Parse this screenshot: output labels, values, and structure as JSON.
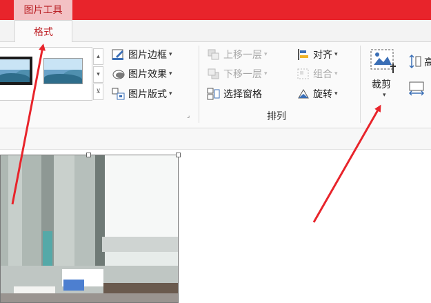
{
  "titlebar": {
    "context_tab_label": "图片工具"
  },
  "tabs": {
    "active_label": "格式"
  },
  "ribbon": {
    "style_group": {
      "border_label": "图片边框",
      "effects_label": "图片效果",
      "layout_label": "图片版式"
    },
    "arrange_group": {
      "group_label": "排列",
      "bring_forward_label": "上移一层",
      "send_backward_label": "下移一层",
      "selection_pane_label": "选择窗格",
      "align_label": "对齐",
      "group_objects_label": "组合",
      "rotate_label": "旋转"
    },
    "size_group": {
      "crop_label": "裁剪",
      "height_partial": "高"
    }
  },
  "colors": {
    "titlebar": "#e8242b",
    "context_tab": "#f3c1c4",
    "active_tab_text": "#c0262b",
    "arrow": "#e8242b"
  },
  "icons": [
    "picture-style-thumbnail",
    "pencil-icon",
    "effects-icon",
    "layout-icon",
    "bring-forward-icon",
    "send-backward-icon",
    "selection-pane-icon",
    "align-icon",
    "group-icon",
    "rotate-icon",
    "crop-icon",
    "height-icon",
    "width-icon"
  ]
}
